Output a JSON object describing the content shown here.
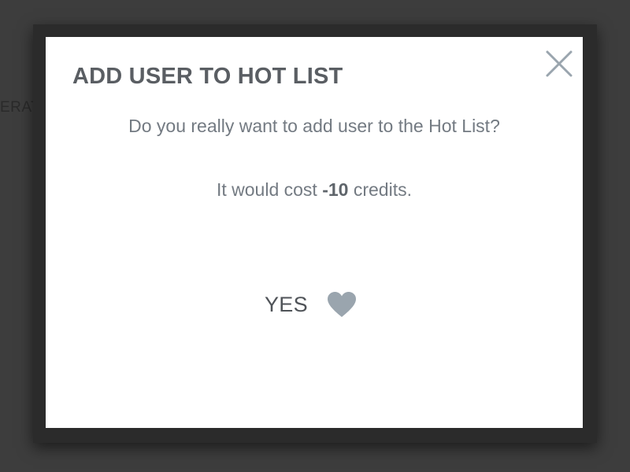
{
  "background": {
    "partial_text": "ERAT"
  },
  "modal": {
    "title": "ADD USER TO HOT LIST",
    "question": "Do you really want to add user to the Hot List?",
    "cost_prefix": "It would cost ",
    "cost_amount": "-10",
    "cost_suffix": " credits.",
    "confirm_label": "YES",
    "confirm_icon": "heart-icon",
    "close_icon": "close-icon"
  },
  "colors": {
    "icon": "#9aa5ae",
    "title": "#5a5e63",
    "text": "#737a82"
  }
}
